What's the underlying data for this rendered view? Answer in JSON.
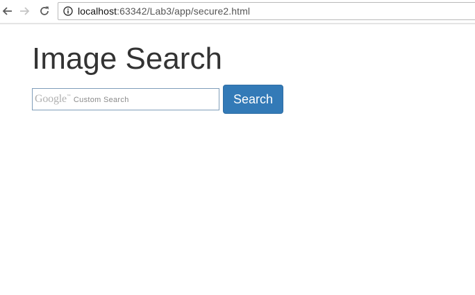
{
  "browser": {
    "url_host": "localhost",
    "url_rest": ":63342/Lab3/app/secure2.html",
    "back_icon": "arrow-left-icon",
    "forward_icon": "arrow-right-icon",
    "reload_icon": "reload-icon",
    "info_icon": "info-icon"
  },
  "page": {
    "title": "Image Search",
    "search": {
      "watermark_logo": "Google",
      "watermark_tm": "™",
      "watermark_text": "Custom Search",
      "value": ""
    },
    "search_button_label": "Search",
    "accent_color": "#337ab7"
  }
}
